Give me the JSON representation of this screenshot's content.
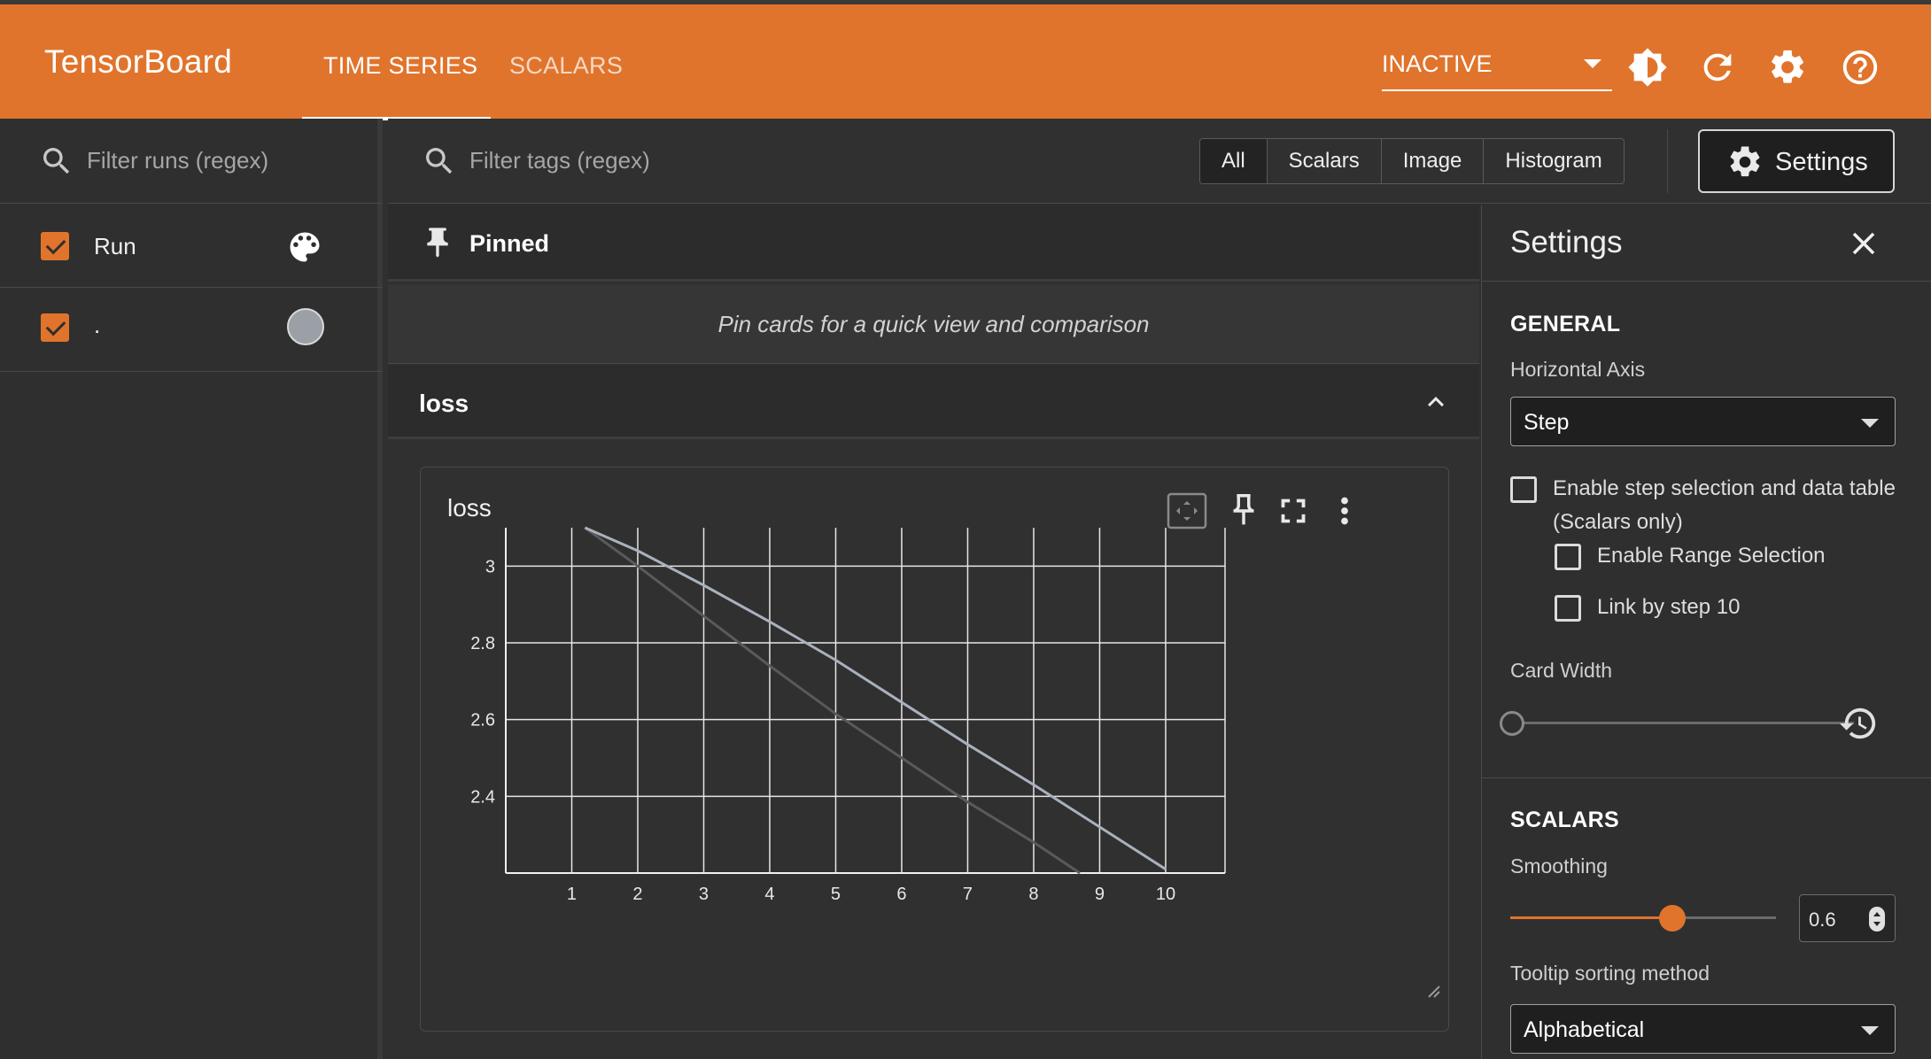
{
  "app": {
    "brand": "TensorBoard"
  },
  "tabs": [
    {
      "label": "TIME SERIES"
    },
    {
      "label": "SCALARS"
    }
  ],
  "header": {
    "run_select": "INACTIVE"
  },
  "runs_panel": {
    "filter_placeholder": "Filter runs (regex)",
    "rows": [
      {
        "label": "Run"
      },
      {
        "label": "."
      }
    ],
    "run_color": "#9aa0a6"
  },
  "toolbar": {
    "filter_placeholder": "Filter tags (regex)",
    "types": [
      "All",
      "Scalars",
      "Image",
      "Histogram"
    ],
    "settings_label": "Settings"
  },
  "pinned": {
    "title": "Pinned",
    "empty_message": "Pin cards for a quick view and comparison"
  },
  "group": {
    "title": "loss"
  },
  "card": {
    "title": "loss"
  },
  "chart_data": {
    "type": "line",
    "xlim": [
      0,
      10.9
    ],
    "ylim": [
      2.2,
      3.1
    ],
    "x_ticks": [
      1,
      2,
      3,
      4,
      5,
      6,
      7,
      8,
      9,
      10
    ],
    "y_ticks": [
      3,
      2.8,
      2.6,
      2.4
    ],
    "y_tick_labels": [
      "3",
      "2.8",
      "2.6",
      "2.4"
    ],
    "grid": true,
    "series": [
      {
        "color": "#a9b1bd",
        "x": [
          1.2,
          2,
          3,
          4,
          5,
          6,
          7,
          8,
          9,
          10
        ],
        "values": [
          3.1,
          3.04,
          2.95,
          2.855,
          2.755,
          2.645,
          2.535,
          2.43,
          2.32,
          2.21
        ]
      },
      {
        "color": "#5a5a5a",
        "x": [
          1.2,
          2,
          3,
          4,
          5,
          6,
          7,
          8,
          8.7
        ],
        "values": [
          3.1,
          3.0,
          2.87,
          2.74,
          2.615,
          2.5,
          2.385,
          2.28,
          2.2
        ]
      }
    ]
  },
  "settings": {
    "title": "Settings",
    "general": {
      "title": "GENERAL",
      "horizontal_axis_label": "Horizontal Axis",
      "horizontal_axis_value": "Step",
      "step_selection_label_1": "Enable step selection and data table",
      "step_selection_label_2": "(Scalars only)",
      "range_selection_label": "Enable Range Selection",
      "link_by_step_label": "Link by step 10",
      "card_width_label": "Card Width"
    },
    "scalars": {
      "title": "SCALARS",
      "smoothing_label": "Smoothing",
      "smoothing_value": "0.6",
      "tooltip_sort_label": "Tooltip sorting method",
      "tooltip_sort_value": "Alphabetical"
    }
  }
}
